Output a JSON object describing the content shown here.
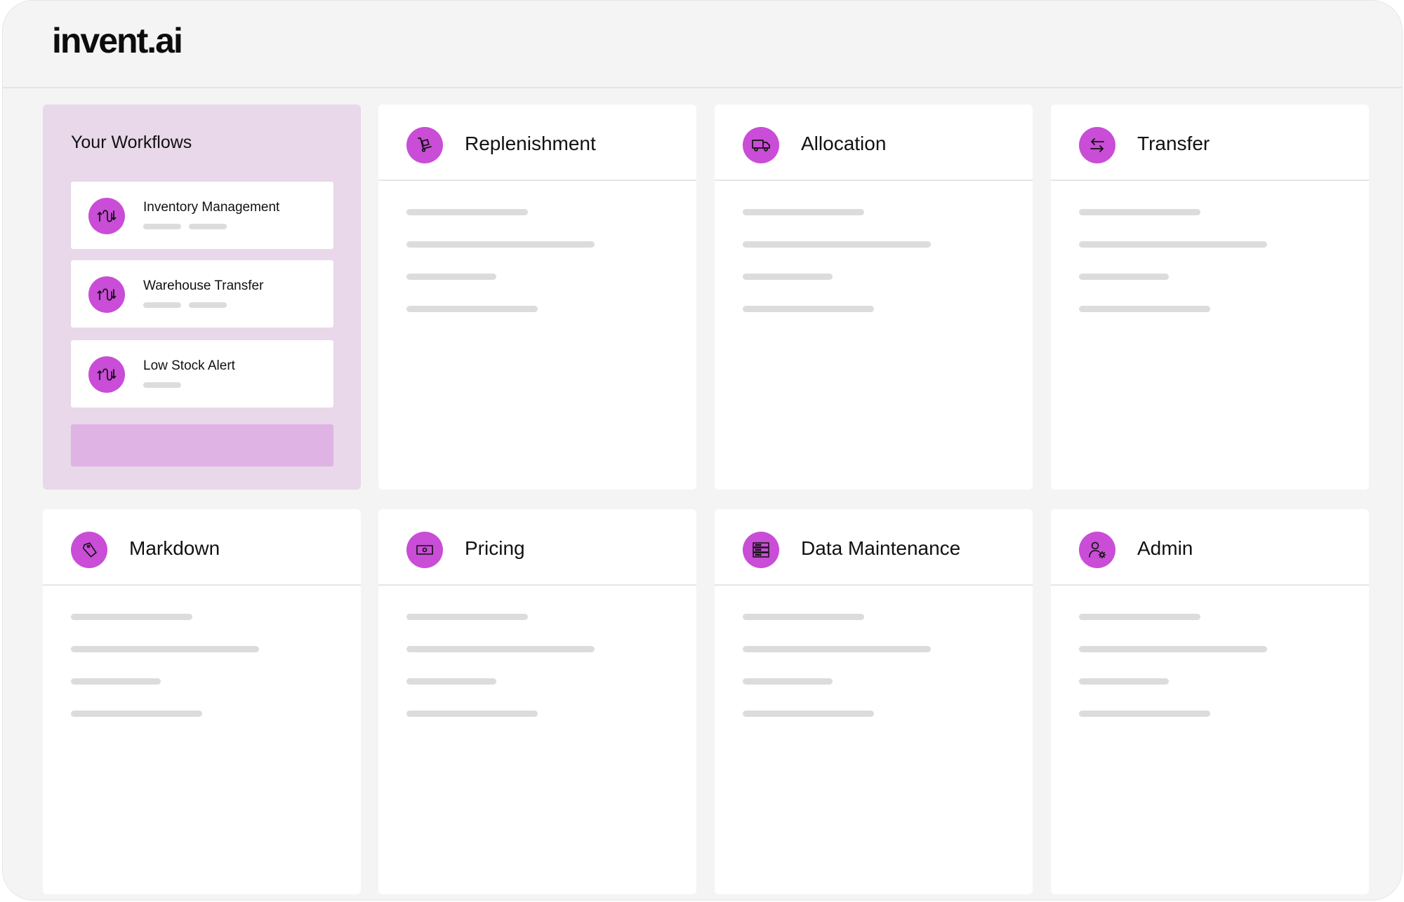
{
  "brand": {
    "logo_text": "invent.ai"
  },
  "colors": {
    "accent": "#c94dd6",
    "workflows_bg": "#e8d8e9",
    "button_bg": "#dfb3e3"
  },
  "workflows": {
    "title": "Your Workflows",
    "items": [
      {
        "label": "Inventory Management",
        "icon": "workflow-icon"
      },
      {
        "label": "Warehouse Transfer",
        "icon": "workflow-icon"
      },
      {
        "label": "Low Stock Alert",
        "icon": "workflow-icon"
      }
    ]
  },
  "modules": [
    {
      "title": "Replenishment",
      "icon": "dolly-icon"
    },
    {
      "title": "Allocation",
      "icon": "truck-icon"
    },
    {
      "title": "Transfer",
      "icon": "transfer-arrows-icon"
    },
    {
      "title": "Markdown",
      "icon": "price-tag-icon"
    },
    {
      "title": "Pricing",
      "icon": "cash-icon"
    },
    {
      "title": "Data Maintenance",
      "icon": "server-icon"
    },
    {
      "title": "Admin",
      "icon": "user-settings-icon"
    }
  ]
}
